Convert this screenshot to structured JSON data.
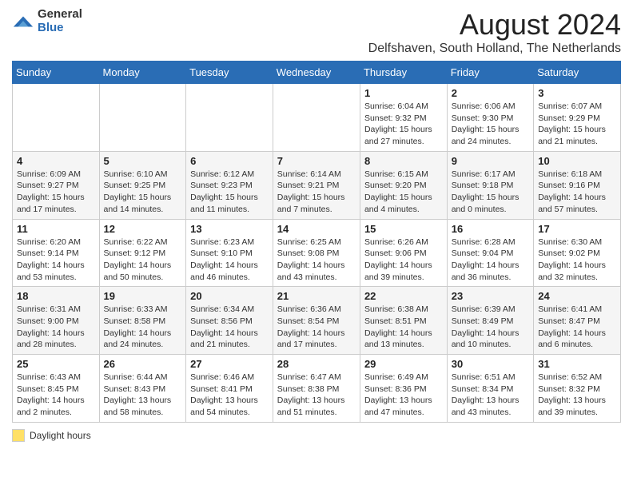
{
  "logo": {
    "general": "General",
    "blue": "Blue"
  },
  "title": {
    "month_year": "August 2024",
    "location": "Delfshaven, South Holland, The Netherlands"
  },
  "headers": [
    "Sunday",
    "Monday",
    "Tuesday",
    "Wednesday",
    "Thursday",
    "Friday",
    "Saturday"
  ],
  "weeks": [
    [
      {
        "day": "",
        "sunrise": "",
        "sunset": "",
        "daylight": ""
      },
      {
        "day": "",
        "sunrise": "",
        "sunset": "",
        "daylight": ""
      },
      {
        "day": "",
        "sunrise": "",
        "sunset": "",
        "daylight": ""
      },
      {
        "day": "",
        "sunrise": "",
        "sunset": "",
        "daylight": ""
      },
      {
        "day": "1",
        "sunrise": "Sunrise: 6:04 AM",
        "sunset": "Sunset: 9:32 PM",
        "daylight": "Daylight: 15 hours and 27 minutes."
      },
      {
        "day": "2",
        "sunrise": "Sunrise: 6:06 AM",
        "sunset": "Sunset: 9:30 PM",
        "daylight": "Daylight: 15 hours and 24 minutes."
      },
      {
        "day": "3",
        "sunrise": "Sunrise: 6:07 AM",
        "sunset": "Sunset: 9:29 PM",
        "daylight": "Daylight: 15 hours and 21 minutes."
      }
    ],
    [
      {
        "day": "4",
        "sunrise": "Sunrise: 6:09 AM",
        "sunset": "Sunset: 9:27 PM",
        "daylight": "Daylight: 15 hours and 17 minutes."
      },
      {
        "day": "5",
        "sunrise": "Sunrise: 6:10 AM",
        "sunset": "Sunset: 9:25 PM",
        "daylight": "Daylight: 15 hours and 14 minutes."
      },
      {
        "day": "6",
        "sunrise": "Sunrise: 6:12 AM",
        "sunset": "Sunset: 9:23 PM",
        "daylight": "Daylight: 15 hours and 11 minutes."
      },
      {
        "day": "7",
        "sunrise": "Sunrise: 6:14 AM",
        "sunset": "Sunset: 9:21 PM",
        "daylight": "Daylight: 15 hours and 7 minutes."
      },
      {
        "day": "8",
        "sunrise": "Sunrise: 6:15 AM",
        "sunset": "Sunset: 9:20 PM",
        "daylight": "Daylight: 15 hours and 4 minutes."
      },
      {
        "day": "9",
        "sunrise": "Sunrise: 6:17 AM",
        "sunset": "Sunset: 9:18 PM",
        "daylight": "Daylight: 15 hours and 0 minutes."
      },
      {
        "day": "10",
        "sunrise": "Sunrise: 6:18 AM",
        "sunset": "Sunset: 9:16 PM",
        "daylight": "Daylight: 14 hours and 57 minutes."
      }
    ],
    [
      {
        "day": "11",
        "sunrise": "Sunrise: 6:20 AM",
        "sunset": "Sunset: 9:14 PM",
        "daylight": "Daylight: 14 hours and 53 minutes."
      },
      {
        "day": "12",
        "sunrise": "Sunrise: 6:22 AM",
        "sunset": "Sunset: 9:12 PM",
        "daylight": "Daylight: 14 hours and 50 minutes."
      },
      {
        "day": "13",
        "sunrise": "Sunrise: 6:23 AM",
        "sunset": "Sunset: 9:10 PM",
        "daylight": "Daylight: 14 hours and 46 minutes."
      },
      {
        "day": "14",
        "sunrise": "Sunrise: 6:25 AM",
        "sunset": "Sunset: 9:08 PM",
        "daylight": "Daylight: 14 hours and 43 minutes."
      },
      {
        "day": "15",
        "sunrise": "Sunrise: 6:26 AM",
        "sunset": "Sunset: 9:06 PM",
        "daylight": "Daylight: 14 hours and 39 minutes."
      },
      {
        "day": "16",
        "sunrise": "Sunrise: 6:28 AM",
        "sunset": "Sunset: 9:04 PM",
        "daylight": "Daylight: 14 hours and 36 minutes."
      },
      {
        "day": "17",
        "sunrise": "Sunrise: 6:30 AM",
        "sunset": "Sunset: 9:02 PM",
        "daylight": "Daylight: 14 hours and 32 minutes."
      }
    ],
    [
      {
        "day": "18",
        "sunrise": "Sunrise: 6:31 AM",
        "sunset": "Sunset: 9:00 PM",
        "daylight": "Daylight: 14 hours and 28 minutes."
      },
      {
        "day": "19",
        "sunrise": "Sunrise: 6:33 AM",
        "sunset": "Sunset: 8:58 PM",
        "daylight": "Daylight: 14 hours and 24 minutes."
      },
      {
        "day": "20",
        "sunrise": "Sunrise: 6:34 AM",
        "sunset": "Sunset: 8:56 PM",
        "daylight": "Daylight: 14 hours and 21 minutes."
      },
      {
        "day": "21",
        "sunrise": "Sunrise: 6:36 AM",
        "sunset": "Sunset: 8:54 PM",
        "daylight": "Daylight: 14 hours and 17 minutes."
      },
      {
        "day": "22",
        "sunrise": "Sunrise: 6:38 AM",
        "sunset": "Sunset: 8:51 PM",
        "daylight": "Daylight: 14 hours and 13 minutes."
      },
      {
        "day": "23",
        "sunrise": "Sunrise: 6:39 AM",
        "sunset": "Sunset: 8:49 PM",
        "daylight": "Daylight: 14 hours and 10 minutes."
      },
      {
        "day": "24",
        "sunrise": "Sunrise: 6:41 AM",
        "sunset": "Sunset: 8:47 PM",
        "daylight": "Daylight: 14 hours and 6 minutes."
      }
    ],
    [
      {
        "day": "25",
        "sunrise": "Sunrise: 6:43 AM",
        "sunset": "Sunset: 8:45 PM",
        "daylight": "Daylight: 14 hours and 2 minutes."
      },
      {
        "day": "26",
        "sunrise": "Sunrise: 6:44 AM",
        "sunset": "Sunset: 8:43 PM",
        "daylight": "Daylight: 13 hours and 58 minutes."
      },
      {
        "day": "27",
        "sunrise": "Sunrise: 6:46 AM",
        "sunset": "Sunset: 8:41 PM",
        "daylight": "Daylight: 13 hours and 54 minutes."
      },
      {
        "day": "28",
        "sunrise": "Sunrise: 6:47 AM",
        "sunset": "Sunset: 8:38 PM",
        "daylight": "Daylight: 13 hours and 51 minutes."
      },
      {
        "day": "29",
        "sunrise": "Sunrise: 6:49 AM",
        "sunset": "Sunset: 8:36 PM",
        "daylight": "Daylight: 13 hours and 47 minutes."
      },
      {
        "day": "30",
        "sunrise": "Sunrise: 6:51 AM",
        "sunset": "Sunset: 8:34 PM",
        "daylight": "Daylight: 13 hours and 43 minutes."
      },
      {
        "day": "31",
        "sunrise": "Sunrise: 6:52 AM",
        "sunset": "Sunset: 8:32 PM",
        "daylight": "Daylight: 13 hours and 39 minutes."
      }
    ]
  ],
  "legend": {
    "box_label": "Daylight hours"
  }
}
